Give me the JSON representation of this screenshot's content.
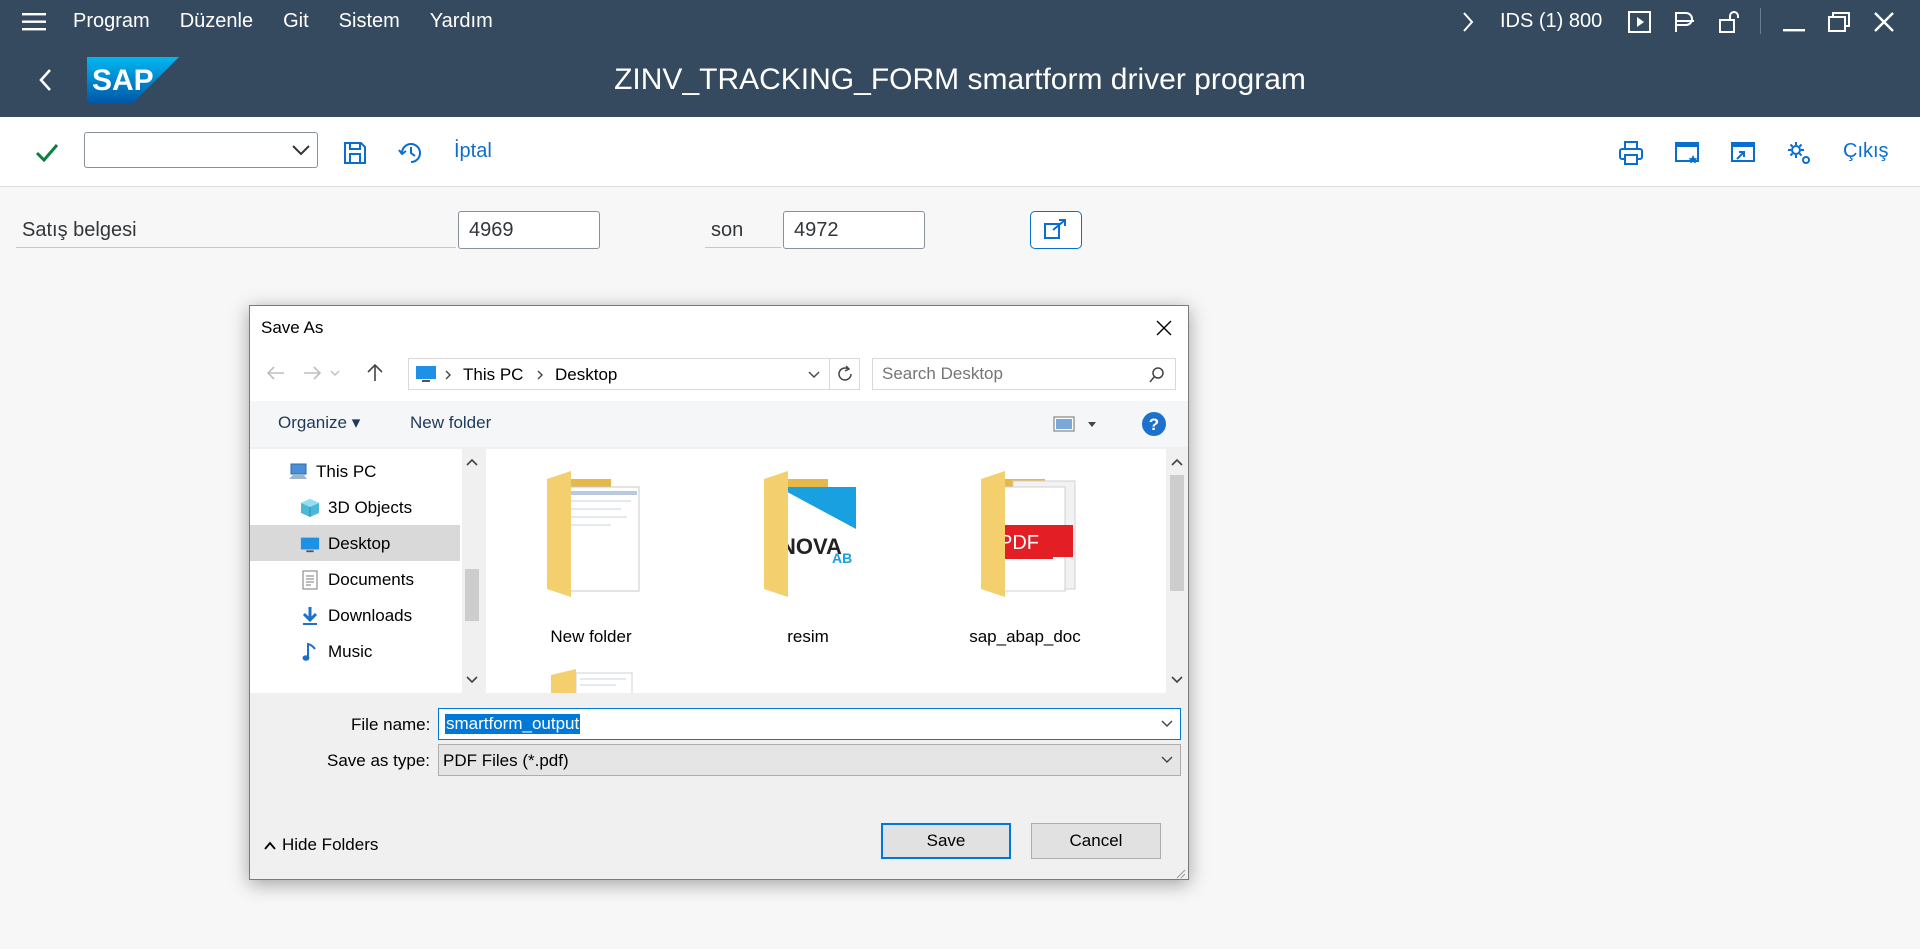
{
  "menubar": {
    "items": [
      "Program",
      "Düzenle",
      "Git",
      "Sistem",
      "Yardım"
    ],
    "system_info": "IDS (1) 800"
  },
  "titlebar": {
    "title": "ZINV_TRACKING_FORM smartform driver program",
    "logo_text": "SAP"
  },
  "toolbar": {
    "command_value": "",
    "cancel_label": "İptal",
    "exit_label": "Çıkış"
  },
  "form": {
    "field_label": "Satış belgesi",
    "from_value": "4969",
    "to_label": "son",
    "to_value": "4972"
  },
  "dialog": {
    "title": "Save As",
    "breadcrumb": [
      "This PC",
      "Desktop"
    ],
    "search_placeholder": "Search Desktop",
    "organize_label": "Organize",
    "new_folder_label": "New folder",
    "tree": [
      {
        "label": "This PC",
        "icon": "pc-icon"
      },
      {
        "label": "3D Objects",
        "icon": "3d-objects-icon"
      },
      {
        "label": "Desktop",
        "icon": "desktop-icon",
        "selected": true
      },
      {
        "label": "Documents",
        "icon": "documents-icon"
      },
      {
        "label": "Downloads",
        "icon": "downloads-icon"
      },
      {
        "label": "Music",
        "icon": "music-icon"
      }
    ],
    "files": [
      {
        "name": "New folder"
      },
      {
        "name": "resim",
        "preview_text_1": "NOVA",
        "preview_text_2": "AB"
      },
      {
        "name": "sap_abap_doc",
        "preview_text": "PDF"
      }
    ],
    "file_name_label": "File name:",
    "file_name_value": "smartform_output",
    "save_type_label": "Save as type:",
    "save_type_value": "PDF Files (*.pdf)",
    "hide_folders_label": "Hide Folders",
    "save_label": "Save",
    "cancel_label": "Cancel"
  },
  "colors": {
    "shell": "#354a5f",
    "accent": "#0a6ed1",
    "win_selection": "#0078d7"
  }
}
